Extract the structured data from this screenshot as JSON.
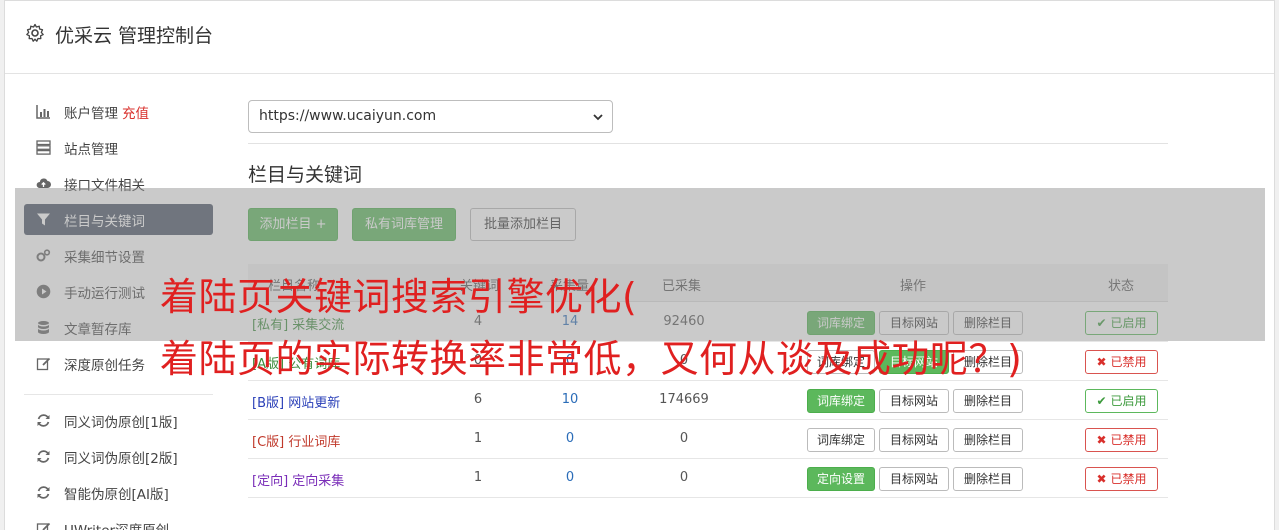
{
  "header": {
    "title": "优采云 管理控制台"
  },
  "sidebar": {
    "items": [
      {
        "label": "账户管理",
        "badge": "充值",
        "icon": "bar-chart-icon"
      },
      {
        "label": "站点管理",
        "icon": "server-icon"
      },
      {
        "label": "接口文件相关",
        "icon": "cloud-upload-icon"
      },
      {
        "label": "栏目与关键词",
        "icon": "filter-icon",
        "active": true
      },
      {
        "label": "采集细节设置",
        "icon": "cogs-icon"
      },
      {
        "label": "手动运行测试",
        "icon": "play-circle-icon"
      },
      {
        "label": "文章暂存库",
        "icon": "database-icon"
      },
      {
        "label": "深度原创任务",
        "icon": "edit-icon"
      },
      {
        "label": "同义词伪原创[1版]",
        "icon": "refresh-icon"
      },
      {
        "label": "同义词伪原创[2版]",
        "icon": "refresh-icon"
      },
      {
        "label": "智能伪原创[AI版]",
        "icon": "refresh-icon"
      },
      {
        "label": "UWriter深度原创",
        "icon": "edit-icon"
      }
    ]
  },
  "site_select": {
    "value": "https://www.ucaiyun.com"
  },
  "section": {
    "title": "栏目与关键词"
  },
  "toolbar": {
    "add_column": "添加栏目 +",
    "private_lib": "私有词库管理",
    "batch_add": "批量添加栏目"
  },
  "table": {
    "headers": [
      "栏目名称",
      "关键词",
      "采集量",
      "已采集",
      "操作",
      "状态"
    ],
    "rows": [
      {
        "tag": "[私有]",
        "name": "采集交流",
        "c1": "4",
        "c2": "14",
        "total": "92460",
        "action1": "词库绑定",
        "action2": "目标网站",
        "action3": "删除栏目",
        "status": "已启用",
        "enabled": true
      },
      {
        "tag": "[A版]",
        "name": "公有词库",
        "c1": "0",
        "c2": "0",
        "total": "0",
        "action1": "词库绑定",
        "action2": "目标网站",
        "action3": "删除栏目",
        "status": "已禁用",
        "enabled": false
      },
      {
        "tag": "[B版]",
        "name": "网站更新",
        "c1": "6",
        "c2": "10",
        "total": "174669",
        "action1": "词库绑定",
        "action2": "目标网站",
        "action3": "删除栏目",
        "status": "已启用",
        "enabled": true
      },
      {
        "tag": "[C版]",
        "name": "行业词库",
        "c1": "1",
        "c2": "0",
        "total": "0",
        "action1": "词库绑定",
        "action2": "目标网站",
        "action3": "删除栏目",
        "status": "已禁用",
        "enabled": false
      },
      {
        "tag": "[定向]",
        "name": "定向采集",
        "c1": "1",
        "c2": "0",
        "total": "0",
        "action1": "定向设置",
        "action2": "目标网站",
        "action3": "删除栏目",
        "status": "已禁用",
        "enabled": false
      }
    ]
  },
  "watermark": {
    "line1": "着陆页关键词搜索引擎优化(",
    "line2": "着陆页的实际转换率非常低，又何从谈及成功呢？)"
  },
  "colors": {
    "accent_green": "#5cb85c",
    "sidebar_active": "#4a5566",
    "danger": "#d9302c",
    "link": "#2a6cb8",
    "watermark": "#e02020"
  }
}
